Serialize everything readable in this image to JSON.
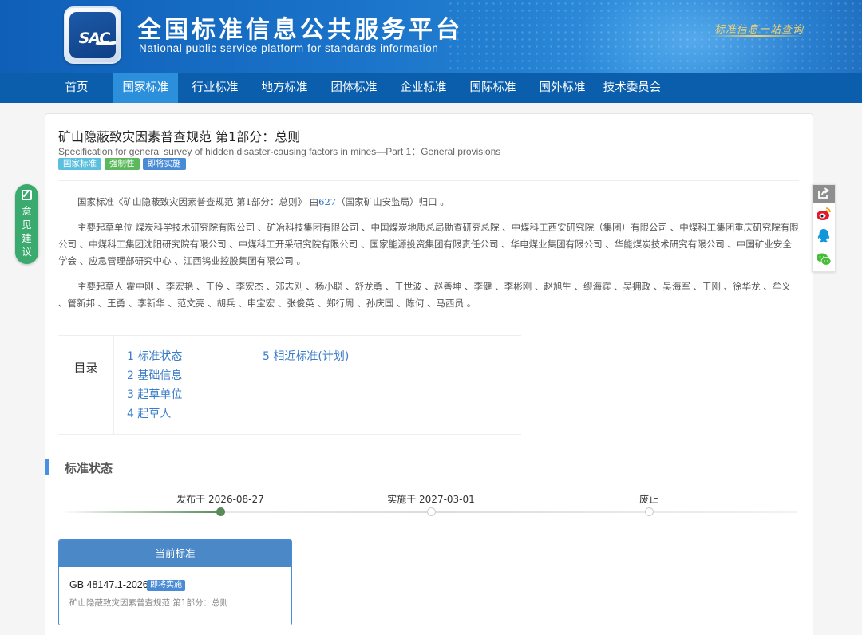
{
  "site": {
    "title_cn": "全国标准信息公共服务平台",
    "title_en": "National public service platform  for standards information",
    "logo_text": "SAC",
    "slogan": "标准信息一站查询"
  },
  "nav": [
    "首页",
    "国家标准",
    "行业标准",
    "地方标准",
    "团体标准",
    "企业标准",
    "国际标准",
    "国外标准",
    "技术委员会"
  ],
  "nav_active": "国家标准",
  "standard": {
    "title": "矿山隐蔽致灾因素普查规范 第1部分：总则",
    "title_en": "Specification for general survey of hidden disaster-causing factors in mines—Part 1：General provisions",
    "tags": [
      "国家标准",
      "强制性",
      "即将实施"
    ]
  },
  "intro": {
    "prefix": "国家标准《矿山隐蔽致灾因素普查规范 第1部分：总则》 由",
    "tc_code": "627",
    "suffix": "（国家矿山安监局）归口 。"
  },
  "drafting_units": "主要起草单位 煤炭科学技术研究院有限公司 、矿冶科技集团有限公司 、中国煤炭地质总局勘查研究总院 、中煤科工西安研究院（集团）有限公司 、中煤科工集团重庆研究院有限公司 、中煤科工集团沈阳研究院有限公司 、中煤科工开采研究院有限公司 、国家能源投资集团有限责任公司 、华电煤业集团有限公司 、华能煤炭技术研究有限公司 、中国矿业安全学会 、应急管理部研究中心 、江西钨业控股集团有限公司 。",
  "drafters": "主要起草人 霍中刚 、李宏艳 、王伶 、李宏杰 、邓志刚 、杨小聪 、舒龙勇 、于世波 、赵善坤 、李健 、李彬刚 、赵旭生 、缪海宾 、吴拥政 、吴海军 、王刚 、徐华龙 、牟义 、管新邦 、王勇 、李新华 、范文亮 、胡兵 、申宝宏 、张俊英 、郑行周 、孙庆国 、陈何 、马西员 。",
  "toc": {
    "label": "目录",
    "items": [
      "1  标准状态",
      "2  基础信息",
      "3  起草单位",
      "4  起草人",
      "5  相近标准(计划)"
    ]
  },
  "status_section": {
    "title": "标准状态",
    "timeline": [
      {
        "label": "发布于 2026-08-27",
        "done": true
      },
      {
        "label": "实施于 2027-03-01",
        "done": false
      },
      {
        "label": "废止",
        "done": false
      }
    ]
  },
  "current": {
    "header": "当前标准",
    "code": "GB 48147.1-2026",
    "badge": "即将实施",
    "name": "矿山隐蔽致灾因素普查规范 第1部分：总则"
  },
  "feedback": {
    "text": "意见建议"
  },
  "share": {
    "icons": [
      "share-icon",
      "weibo-icon",
      "qq-icon",
      "wechat-icon"
    ]
  },
  "colors": {
    "brand": "#0a5eac",
    "nav_active": "#2b8fdc",
    "link": "#3a7cc8",
    "feedback": "#3aaa6e"
  }
}
